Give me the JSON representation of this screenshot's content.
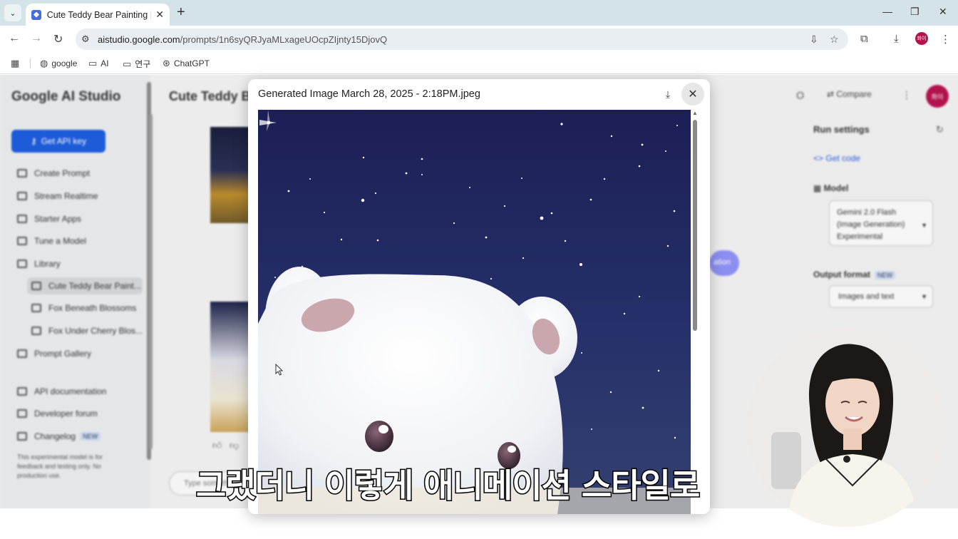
{
  "browser": {
    "tab_title": "Cute Teddy Bear Painting | Go",
    "url_host": "aistudio.google.com",
    "url_path": "/prompts/1n6syQRJyaMLxageUOcpZIjnty15DjovQ",
    "profile_initials": "화이",
    "bookmarks": [
      {
        "label": "google",
        "icon": "globe-icon"
      },
      {
        "label": "AI",
        "icon": "folder-icon"
      },
      {
        "label": "연구",
        "icon": "folder-icon"
      },
      {
        "label": "ChatGPT",
        "icon": "chatgpt-icon"
      }
    ]
  },
  "studio": {
    "logo": "Google AI Studio",
    "api_key_button": "Get API key",
    "nav": [
      {
        "label": "Create Prompt",
        "icon": "create-icon"
      },
      {
        "label": "Stream Realtime",
        "icon": "stream-icon"
      },
      {
        "label": "Starter Apps",
        "icon": "apps-icon"
      },
      {
        "label": "Tune a Model",
        "icon": "tune-icon"
      },
      {
        "label": "Library",
        "icon": "library-icon"
      }
    ],
    "library_items": [
      "Cute Teddy Bear Paint...",
      "Fox Beneath Blossoms",
      "Fox Under Cherry Blos..."
    ],
    "nav_bottom": [
      {
        "label": "Prompt Gallery",
        "icon": "gallery-icon"
      },
      {
        "label": "API documentation",
        "icon": "docs-icon"
      },
      {
        "label": "Developer forum",
        "icon": "forum-icon"
      },
      {
        "label": "Changelog",
        "icon": "changelog-icon",
        "badge": "NEW"
      }
    ],
    "side_note": "This experimental model is for feedback and testing only. No production use.",
    "main_title": "Cute Teddy Bear Painting",
    "prompt_placeholder": "Type something",
    "run_chip": "ation",
    "compare_label": "Compare",
    "user_initials": "화이"
  },
  "run_settings": {
    "title": "Run settings",
    "get_code": "Get code",
    "model_label": "Model",
    "model_value": "Gemini 2.0 Flash (Image Generation) Experimental",
    "output_format_label": "Output format",
    "output_format_badge": "NEW",
    "output_format_value": "Images and text"
  },
  "modal": {
    "title": "Generated Image March 28, 2025 - 2:18PM.jpeg",
    "image_description": "Animated-style white teddy bear under a starry night sky"
  },
  "overlay": {
    "subtitle": "그랬더니 이렇게 애니메이션 스타일로"
  },
  "colors": {
    "accent_blue": "#1d5bd8",
    "avatar": "#b3134d",
    "night_sky": "#232a5e"
  }
}
